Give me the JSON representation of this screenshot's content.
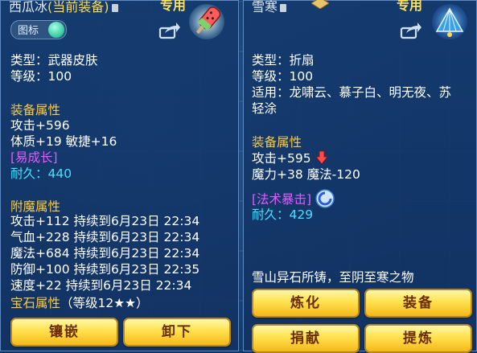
{
  "left": {
    "title_name": "西瓜冰",
    "title_sub": "(当前装备)",
    "exclusive": "专用",
    "toggle_label": "图标",
    "type": "类型：武器皮肤",
    "level": "等级：100",
    "equip_attr_head": "装备属性",
    "attr_lines": [
      "攻击+596",
      "体质+19 敏捷+16"
    ],
    "tag": "[易成长]",
    "durability": "耐久：440",
    "enchant_head": "附魔属性",
    "enchant_lines": [
      "攻击+112 持续到6月23日 22:34",
      "气血+228 持续到6月23日 22:34",
      "魔法+684 持续到6月23日 22:34",
      "防御+100 持续到6月23日 22:35",
      "速度+22 持续到6月23日 22:34"
    ],
    "gem_head": "宝石属性",
    "gem_level": "（等级12★★）",
    "buttons": {
      "inlay": "镶嵌",
      "unequip": "卸下"
    }
  },
  "right": {
    "title_name": "雪寒",
    "exclusive": "专用",
    "type": "类型：折扇",
    "level": "等级：100",
    "usable_line1": "适用：龙啸云、慕子白、明无夜、苏",
    "usable_line2": "轻涂",
    "equip_attr_head": "装备属性",
    "attack": "攻击+595",
    "magic": "魔力+38 魔法-120",
    "skill_tag": "[法术暴击]",
    "durability": "耐久：429",
    "description": "雪山异石所铸，至阴至寒之物",
    "buttons": {
      "refine": "炼化",
      "equip": "装备",
      "donate": "捐献",
      "extract": "提炼"
    }
  },
  "colors": {
    "accent": "#f7c948",
    "magenta": "#e05cff",
    "cyan": "#45e0ff",
    "button": "#ffe14e"
  }
}
